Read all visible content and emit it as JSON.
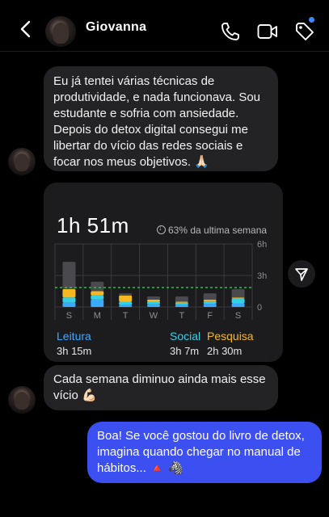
{
  "header": {
    "contact_name": "Giovanna"
  },
  "messages": [
    {
      "from": "them",
      "text": "Eu já tentei várias técnicas de produtividade, e nada funcionava. Sou estudante e sofria com ansiedade. Depois do detox digital consegui me libertar do vício das redes sociais e focar nos meus objetivos. 🙏🏻"
    },
    {
      "from": "them",
      "text": "Cada semana diminuo ainda mais esse vício 💪🏻"
    },
    {
      "from": "me",
      "text": "Boa! Se você gostou do livro de detox, imagina quando chegar no manual de hábitos... 🔺 🦓"
    }
  ],
  "screen_time_card": {
    "total": "1h 51m",
    "comparison": "63% da ultima semana",
    "legend": [
      {
        "name": "Leitura",
        "value": "3h 15m",
        "color": "#3aa9ff"
      },
      {
        "name": "Social",
        "value": "3h 7m",
        "color": "#35d0e8"
      },
      {
        "name": "Pesquisa",
        "value": "2h 30m",
        "color": "#f5b820"
      }
    ]
  },
  "chart_data": {
    "type": "bar",
    "stacked": true,
    "categories": [
      "S",
      "M",
      "T",
      "W",
      "T",
      "F",
      "S"
    ],
    "y_ticks": [
      "6h",
      "3h",
      "0"
    ],
    "ylim": [
      0,
      6
    ],
    "average_line": 1.85,
    "series": [
      {
        "name": "Leitura",
        "color": "#3aa9ff",
        "values": [
          0.4,
          0.7,
          0.2,
          0.25,
          0.2,
          0.3,
          0.35
        ]
      },
      {
        "name": "Social",
        "color": "#35d0e8",
        "values": [
          0.5,
          0.4,
          0.3,
          0.25,
          0.2,
          0.25,
          0.45
        ]
      },
      {
        "name": "Pesquisa",
        "color": "#f5b820",
        "values": [
          0.8,
          0.4,
          0.6,
          0.2,
          0.1,
          0.15,
          0.1
        ]
      },
      {
        "color": "#4a4a4e",
        "values": [
          2.6,
          0.9,
          0.2,
          0.3,
          0.5,
          0.6,
          0.8
        ]
      }
    ]
  }
}
